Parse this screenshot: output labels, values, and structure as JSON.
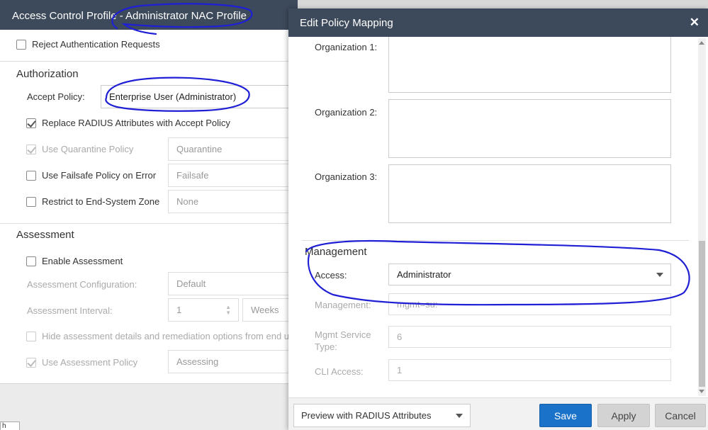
{
  "back_dialog": {
    "title": "Access Control Profile - Administrator NAC Profile",
    "reject_auth": "Reject Authentication Requests",
    "authorization": {
      "section_title": "Authorization",
      "accept_policy_label": "Accept Policy:",
      "accept_policy_value": "Enterprise User (Administrator)",
      "replace_radius": "Replace RADIUS Attributes with Accept Policy",
      "use_quarantine": "Use Quarantine Policy",
      "quarantine_value": "Quarantine",
      "use_failsafe": "Use Failsafe Policy on Error",
      "failsafe_value": "Failsafe",
      "restrict_zone": "Restrict to End-System Zone",
      "zone_value": "None"
    },
    "assessment": {
      "section_title": "Assessment",
      "enable": "Enable Assessment",
      "config_label": "Assessment Configuration:",
      "config_value": "Default",
      "interval_label": "Assessment Interval:",
      "interval_value": "1",
      "interval_unit": "Weeks",
      "hide_details": "Hide assessment details and remediation options from end u",
      "use_policy": "Use Assessment Policy",
      "policy_value": "Assessing"
    },
    "footer_stub": "h"
  },
  "front_dialog": {
    "title": "Edit Policy Mapping",
    "close_icon": "close-icon",
    "org1_label": "Organization 1:",
    "org2_label": "Organization 2:",
    "org3_label": "Organization 3:",
    "management_section": "Management",
    "access_label": "Access:",
    "access_value": "Administrator",
    "management_label": "Management:",
    "management_value": "mgmt=su:",
    "mgmt_service_type_label": "Mgmt Service Type:",
    "mgmt_service_type_value": "6",
    "cli_access_label": "CLI Access:",
    "cli_access_value": "1",
    "preview_select": "Preview with RADIUS Attributes",
    "save": "Save",
    "apply": "Apply",
    "cancel": "Cancel"
  },
  "colors": {
    "titlebar": "#3d4a5c",
    "save_button": "#1a73c9",
    "annotation_ink": "#1f1fd6"
  }
}
